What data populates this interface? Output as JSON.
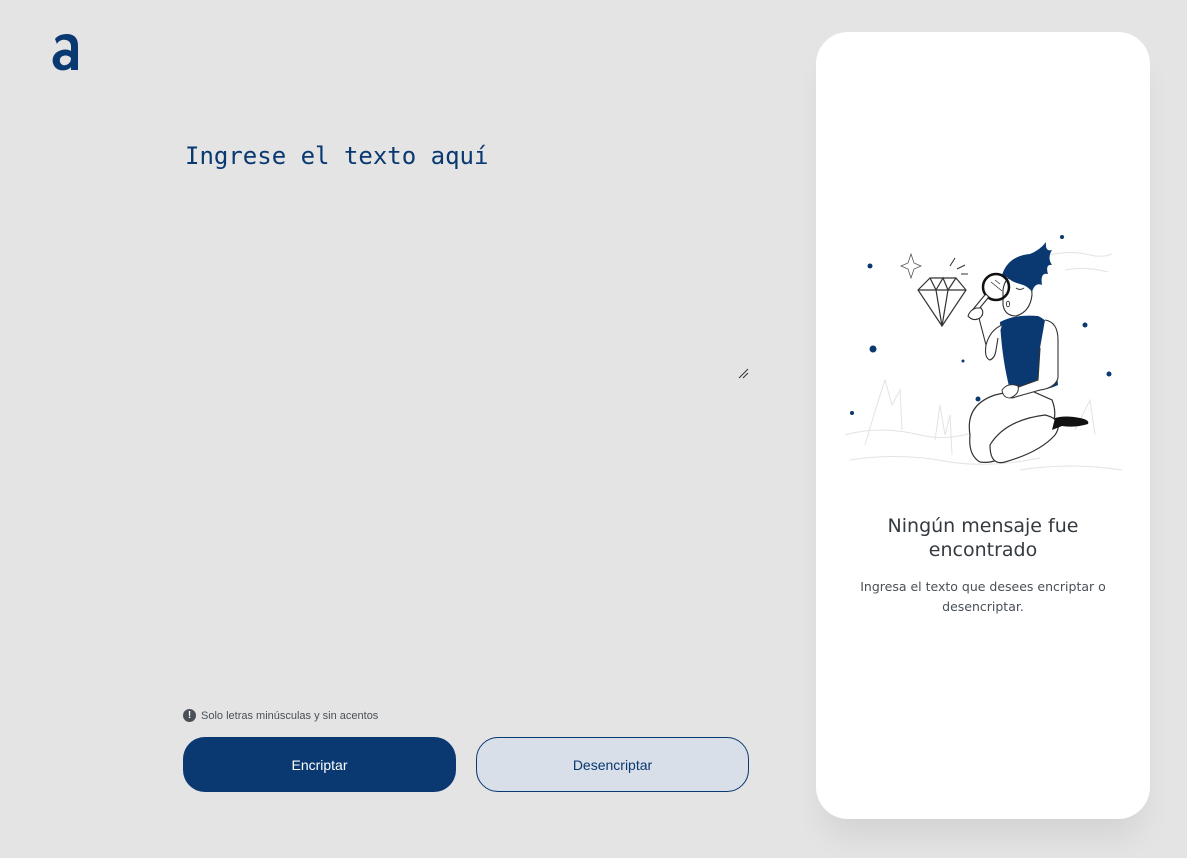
{
  "logo": {
    "icon": "brand-logo-a-icon",
    "color": "#0a3871"
  },
  "input": {
    "placeholder": "Ingrese el texto aquí",
    "value": ""
  },
  "hint": {
    "icon": "info-icon",
    "icon_glyph": "!",
    "text": "Solo letras minúsculas y sin acentos"
  },
  "buttons": {
    "encrypt_label": "Encriptar",
    "decrypt_label": "Desencriptar"
  },
  "result_panel": {
    "illustration": "person-with-magnifying-glass-illustration",
    "title": "Ningún mensaje fue encontrado",
    "subtitle": "Ingresa el texto que desees encriptar o desencriptar."
  },
  "colors": {
    "background": "#e4e4e4",
    "accent": "#0a3871",
    "secondary_button": "#d8dfe8",
    "panel": "#ffffff"
  }
}
